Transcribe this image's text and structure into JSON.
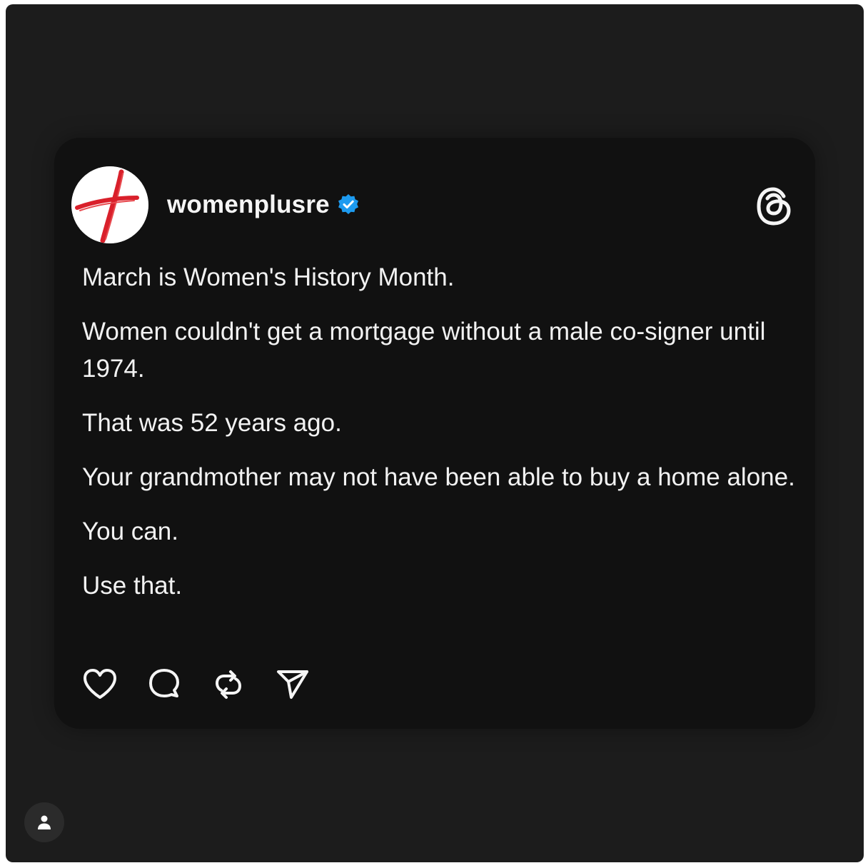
{
  "post": {
    "username": "womenplusre",
    "verified": true,
    "paragraphs": [
      "March is Women's History Month.",
      "Women couldn't get a mortgage without a male co-signer until 1974.",
      "That was 52 years ago.",
      "Your grandmother may not have been able to buy a home alone.",
      "You can.",
      "Use that."
    ]
  },
  "icons": {
    "avatar": "red-cross-logo-icon",
    "verified": "verified-badge-icon",
    "brand": "threads-logo-icon",
    "like": "heart-icon",
    "comment": "comment-bubble-icon",
    "repost": "repost-icon",
    "share": "send-icon",
    "account": "user-icon"
  },
  "colors": {
    "background": "#1c1c1c",
    "card": "#111111",
    "text": "#f2f2f2",
    "verified": "#1d9bf0",
    "logo_red": "#d9202b"
  }
}
